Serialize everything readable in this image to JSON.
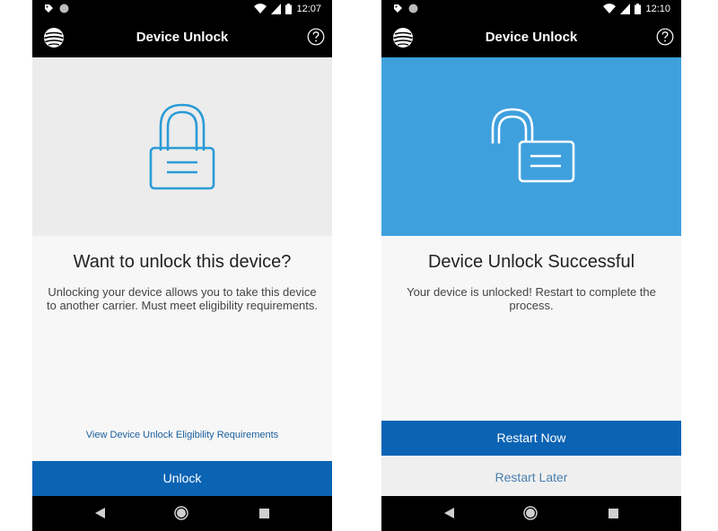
{
  "left_screen": {
    "status": {
      "time": "12:07"
    },
    "app_bar": {
      "title": "Device Unlock",
      "logo_icon": "att-globe-icon",
      "help_icon": "help-circle-icon"
    },
    "hero": {
      "icon": "lock-closed-icon",
      "background": "#ececec"
    },
    "heading": "Want to unlock this device?",
    "body": "Unlocking your device allows you to take this device to another carrier. Must meet eligibility requirements.",
    "link": "View Device Unlock Eligibility Requirements",
    "primary_button": "Unlock"
  },
  "right_screen": {
    "status": {
      "time": "12:10"
    },
    "app_bar": {
      "title": "Device Unlock",
      "logo_icon": "att-globe-icon",
      "help_icon": "help-circle-icon"
    },
    "hero": {
      "icon": "lock-open-icon",
      "background": "#3fa0de"
    },
    "heading": "Device Unlock Successful",
    "body": "Your device is unlocked! Restart to complete the process.",
    "primary_button": "Restart Now",
    "secondary_button": "Restart Later"
  },
  "colors": {
    "accent_blue": "#0b63b4",
    "hero_blue": "#3fa0de",
    "lock_outline_blue": "#2a9bd6"
  }
}
